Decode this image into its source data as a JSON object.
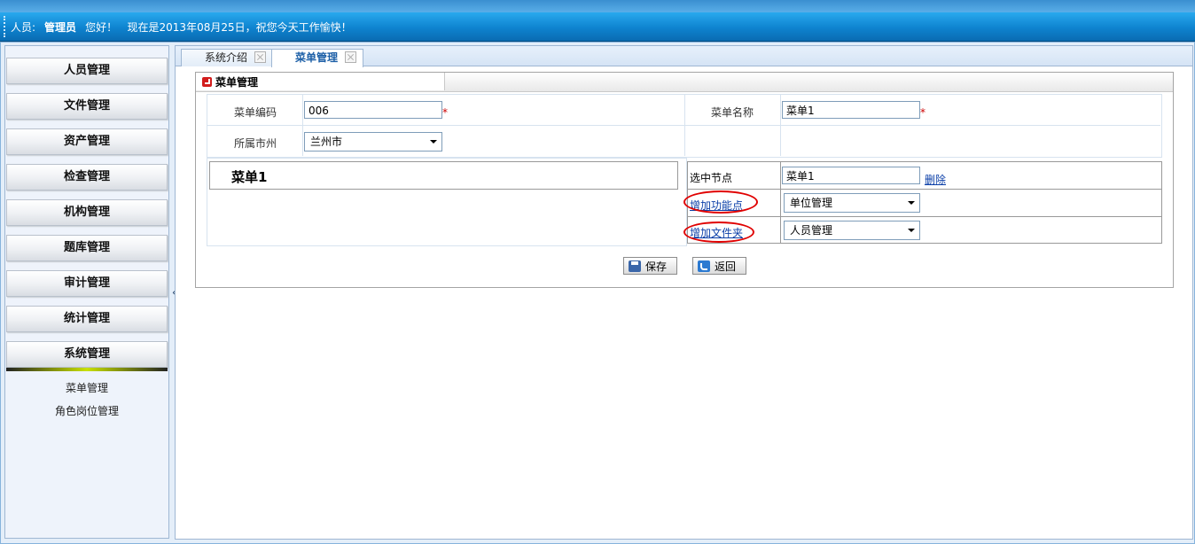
{
  "header": {
    "user_label": "人员:",
    "user_name": "管理员",
    "greeting": "您好！",
    "date_text": "现在是2013年08月25日，祝您今天工作愉快！"
  },
  "sidebar": {
    "items": [
      {
        "label": "人员管理"
      },
      {
        "label": "文件管理"
      },
      {
        "label": "资产管理"
      },
      {
        "label": "检查管理"
      },
      {
        "label": "机构管理"
      },
      {
        "label": "题库管理"
      },
      {
        "label": "审计管理"
      },
      {
        "label": "统计管理"
      },
      {
        "label": "系统管理"
      }
    ],
    "subitems": [
      {
        "label": "菜单管理"
      },
      {
        "label": "角色岗位管理"
      }
    ],
    "collapse_label": "«"
  },
  "tabs": [
    {
      "label": "系统介绍"
    },
    {
      "label": "菜单管理"
    }
  ],
  "panel": {
    "title": "菜单管理",
    "form": {
      "code_label": "菜单编码",
      "code_value": "006",
      "name_label": "菜单名称",
      "name_value": "菜单1",
      "city_label": "所属市州",
      "city_value": "兰州市",
      "required_mark": "*"
    },
    "tree_root": "菜单1",
    "node": {
      "selected_label": "选中节点",
      "selected_value": "菜单1",
      "delete_link": "删除",
      "add_function_link": "增加功能点",
      "function_value": "单位管理",
      "add_folder_link": "增加文件夹",
      "folder_value": "人员管理"
    },
    "buttons": {
      "save": "保存",
      "back": "返回"
    }
  }
}
